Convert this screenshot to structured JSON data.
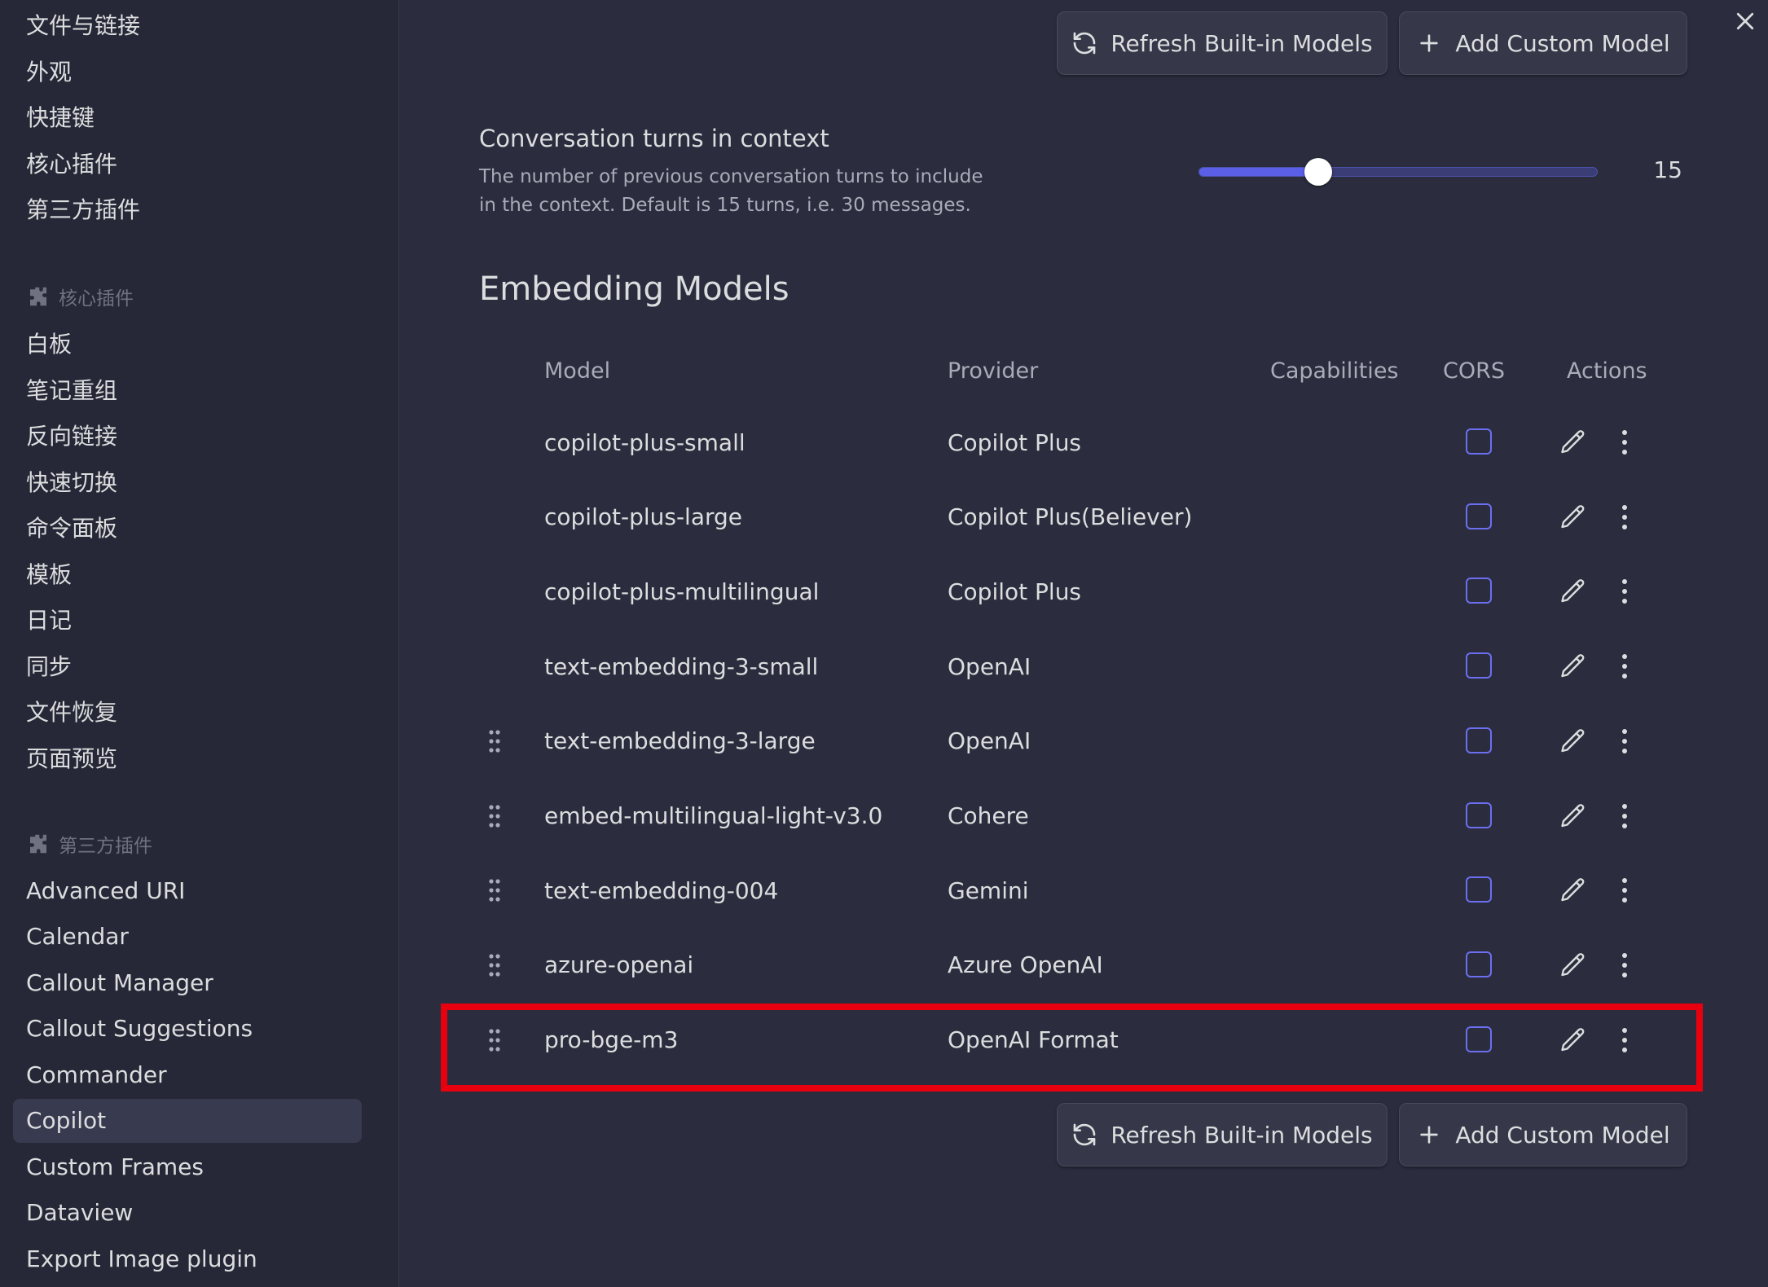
{
  "sidebar": {
    "general_items": [
      "文件与链接",
      "外观",
      "快捷键",
      "核心插件",
      "第三方插件"
    ],
    "core_heading": "核心插件",
    "core_items": [
      "白板",
      "笔记重组",
      "反向链接",
      "快速切换",
      "命令面板",
      "模板",
      "日记",
      "同步",
      "文件恢复",
      "页面预览"
    ],
    "community_heading": "第三方插件",
    "community_items": [
      "Advanced URI",
      "Calendar",
      "Callout Manager",
      "Callout Suggestions",
      "Commander",
      "Copilot",
      "Custom Frames",
      "Dataview",
      "Export Image plugin"
    ],
    "active_item": "Copilot"
  },
  "buttons": {
    "refresh_label": "Refresh Built-in Models",
    "add_label": "Add Custom Model"
  },
  "setting": {
    "name": "Conversation turns in context",
    "description_line1": "The number of previous conversation turns to include",
    "description_line2": "in the context. Default is 15 turns, i.e. 30 messages.",
    "value": "15",
    "slider_fraction": 0.3
  },
  "section": {
    "title": "Embedding Models"
  },
  "table": {
    "headers": {
      "model": "Model",
      "provider": "Provider",
      "capabilities": "Capabilities",
      "cors": "CORS",
      "actions": "Actions"
    },
    "rows": [
      {
        "model": "copilot-plus-small",
        "provider": "Copilot Plus",
        "draggable": false
      },
      {
        "model": "copilot-plus-large",
        "provider": "Copilot Plus(Believer)",
        "draggable": false
      },
      {
        "model": "copilot-plus-multilingual",
        "provider": "Copilot Plus",
        "draggable": false
      },
      {
        "model": "text-embedding-3-small",
        "provider": "OpenAI",
        "draggable": false
      },
      {
        "model": "text-embedding-3-large",
        "provider": "OpenAI",
        "draggable": true
      },
      {
        "model": "embed-multilingual-light-v3.0",
        "provider": "Cohere",
        "draggable": true
      },
      {
        "model": "text-embedding-004",
        "provider": "Gemini",
        "draggable": true
      },
      {
        "model": "azure-openai",
        "provider": "Azure OpenAI",
        "draggable": true
      },
      {
        "model": "pro-bge-m3",
        "provider": "OpenAI Format",
        "draggable": true
      }
    ]
  },
  "colors": {
    "accent": "#5b5ee6",
    "highlight": "#e8000e",
    "background": "#2b2d3e",
    "sidebar": "#262837"
  },
  "icons": {
    "close": "close-icon",
    "refresh": "refresh-icon",
    "add": "plus-icon",
    "edit": "pencil-icon",
    "more": "more-vertical-icon",
    "drag": "drag-handle-icon",
    "plugin": "puzzle-icon"
  }
}
